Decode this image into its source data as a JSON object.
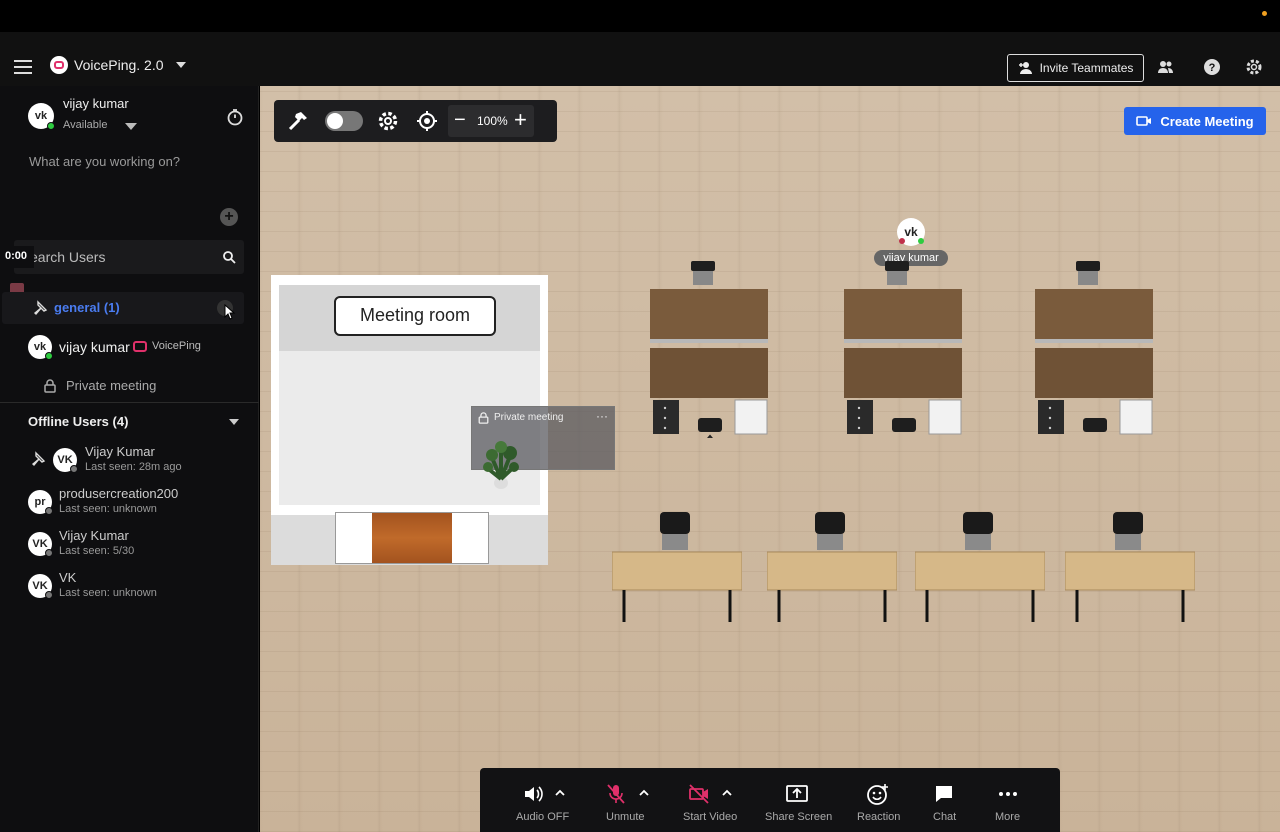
{
  "header": {
    "workspace_name": "VoicePing. 2.0",
    "invite_label": "Invite Teammates"
  },
  "profile": {
    "initials": "vk",
    "name": "vijay kumar",
    "status": "Available",
    "status_placeholder": "What are you working on?"
  },
  "search": {
    "placeholder": "earch Users"
  },
  "overlay_time": "0:00",
  "channel": {
    "name": "general (1)",
    "member": {
      "initials": "vk",
      "name": "vijay kumar",
      "app_tag": "VoicePing"
    },
    "room": "Private meeting"
  },
  "offline": {
    "title": "Offline Users (4)",
    "users": [
      {
        "initials": "VK",
        "name": "Vijay Kumar",
        "last_seen": "Last seen: 28m ago"
      },
      {
        "initials": "pr",
        "name": "produsercreation200",
        "last_seen": "Last seen: unknown"
      },
      {
        "initials": "VK",
        "name": "Vijay Kumar",
        "last_seen": "Last seen: 5/30"
      },
      {
        "initials": "VK",
        "name": "VK",
        "last_seen": "Last seen: unknown"
      }
    ]
  },
  "map": {
    "zoom": "100%",
    "create_meeting_label": "Create Meeting",
    "meeting_room_label": "Meeting room",
    "private_meeting_label": "Private meeting",
    "user_marker": {
      "initials": "vk",
      "name": "vijay kumar"
    }
  },
  "controls": {
    "audio": "Audio OFF",
    "unmute": "Unmute",
    "start_video": "Start Video",
    "share_screen": "Share Screen",
    "reaction": "Reaction",
    "chat": "Chat",
    "more": "More"
  },
  "colors": {
    "accent_blue": "#2563eb",
    "channel_blue": "#4a7cf0",
    "muted_pink": "#e0306a",
    "online_green": "#2ecc40"
  }
}
